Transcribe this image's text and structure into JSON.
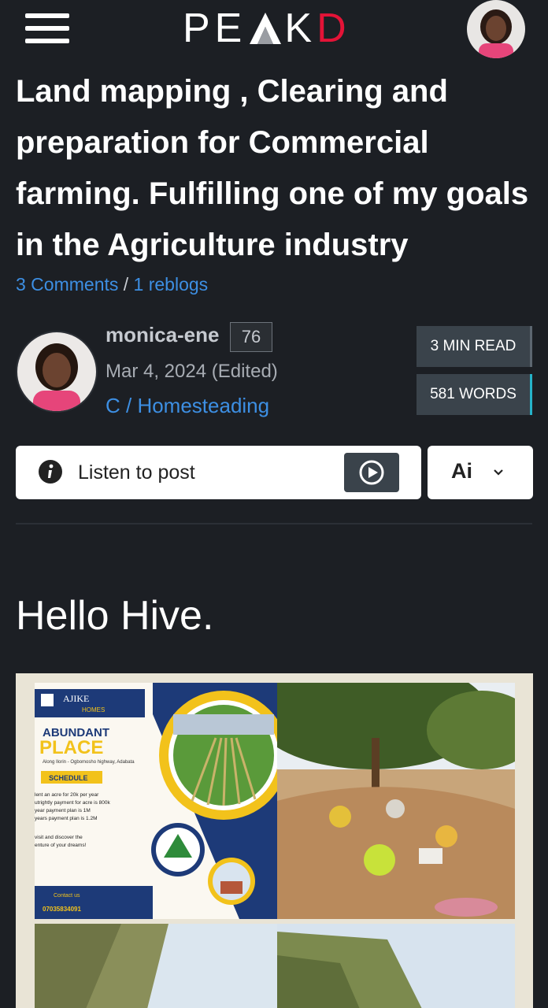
{
  "header": {
    "logo_text": "PEAKD",
    "menu_icon": "hamburger-menu-icon",
    "accent_color": "#e31337"
  },
  "post": {
    "title": "Land mapping , Clearing and preparation for Commercial farming. Fulfilling one of my goals in the Agriculture industry",
    "comments_link": "3 Comments",
    "separator": "/",
    "reblogs_link": "1 reblogs",
    "author": "monica-ene",
    "reputation": "76",
    "date": "Mar 4, 2024 (Edited)",
    "community": "C / Homesteading",
    "read_time": "3 MIN READ",
    "word_count": "581 WORDS"
  },
  "listen": {
    "label": "Listen to post",
    "info_icon": "info-icon",
    "play_icon": "play-circle-icon"
  },
  "ai": {
    "label": "Ai",
    "chevron_icon": "chevron-down-icon"
  },
  "body": {
    "greeting": "Hello Hive."
  },
  "flyer": {
    "brand_line1": "AJIKE",
    "brand_line2": "HOMES",
    "headline1": "ABUNDANT",
    "headline2": "PLACE",
    "address": "Along Ilorin - Ogbomosho highway, Adabata",
    "schedule_label": "SCHEDULE",
    "line1": "lent an acre for 20k per year",
    "line2": "utrightly payment for acre is 800k",
    "line3": "year payment plan is 1M",
    "line4": "years payment plan is 1.2M",
    "line5": "visit and discover the",
    "line6": "enture of your dreams!",
    "contact_label": "Contact us",
    "phone": "07035834091"
  }
}
